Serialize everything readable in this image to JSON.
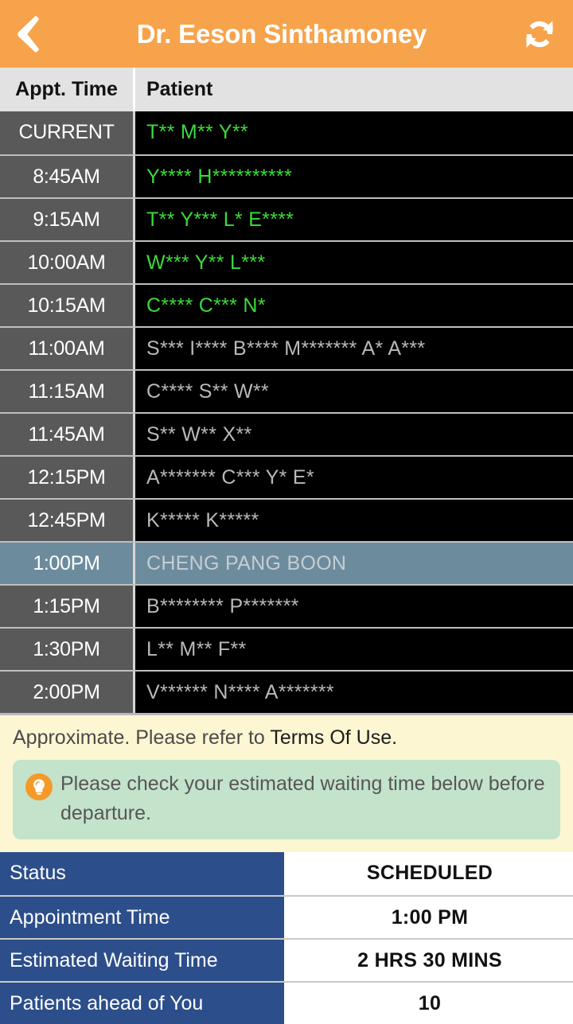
{
  "appbar": {
    "back_icon": "chevron-left-icon",
    "title": "Dr. Eeson Sinthamoney",
    "refresh_icon": "refresh-icon"
  },
  "schedule": {
    "columns": [
      "Appt. Time",
      "Patient"
    ],
    "rows": [
      {
        "time": "CURRENT",
        "patient": "T** M** Y**",
        "state": "green"
      },
      {
        "time": "8:45AM",
        "patient": "Y**** H**********",
        "state": "green"
      },
      {
        "time": "9:15AM",
        "patient": "T** Y*** L* E****",
        "state": "green"
      },
      {
        "time": "10:00AM",
        "patient": "W*** Y** L***",
        "state": "green"
      },
      {
        "time": "10:15AM",
        "patient": "C**** C*** N*",
        "state": "green"
      },
      {
        "time": "11:00AM",
        "patient": "S*** I**** B**** M******* A* A***",
        "state": "normal"
      },
      {
        "time": "11:15AM",
        "patient": "C**** S** W**",
        "state": "normal"
      },
      {
        "time": "11:45AM",
        "patient": "S** W** X**",
        "state": "normal"
      },
      {
        "time": "12:15PM",
        "patient": "A******* C*** Y* E*",
        "state": "normal"
      },
      {
        "time": "12:45PM",
        "patient": "K***** K*****",
        "state": "normal"
      },
      {
        "time": "1:00PM",
        "patient": "CHENG PANG BOON",
        "state": "mine"
      },
      {
        "time": "1:15PM",
        "patient": "B******** P*******",
        "state": "normal"
      },
      {
        "time": "1:30PM",
        "patient": "L** M** F**",
        "state": "normal"
      },
      {
        "time": "2:00PM",
        "patient": "V****** N**** A*******",
        "state": "normal"
      }
    ]
  },
  "notice": {
    "approximate_text": "Approximate. Please refer to ",
    "terms_link": "Terms Of Use.",
    "tip_icon": "lightbulb-icon",
    "tip_text": "Please check your estimated waiting time below before departure."
  },
  "status": {
    "rows": [
      {
        "label": "Status",
        "value": "SCHEDULED"
      },
      {
        "label": "Appointment Time",
        "value": "1:00 PM"
      },
      {
        "label": "Estimated Waiting Time",
        "value": "2 HRS 30 MINS"
      },
      {
        "label": "Patients ahead of You",
        "value": "10"
      }
    ]
  },
  "colors": {
    "appbar": "#F7A34B",
    "row_time_bg": "#595959",
    "row_patient_bg": "#000000",
    "green_text": "#3CDB3C",
    "gray_text": "#B9B9B9",
    "highlight_row": "#6C8C9E",
    "notice_bg": "#FCF6D2",
    "tip_bg": "#C3E3CA",
    "status_label_bg": "#2C4E8A"
  }
}
